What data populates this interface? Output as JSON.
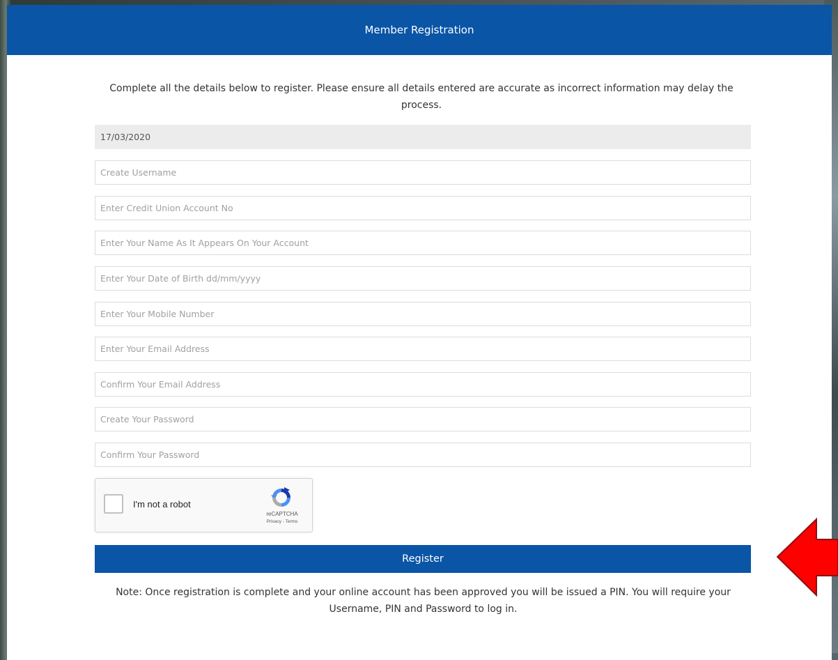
{
  "header": {
    "title": "Member Registration"
  },
  "intro": {
    "text": "Complete all the details below to register. Please ensure all details entered are accurate as incorrect information may delay the process."
  },
  "form": {
    "date": {
      "value": "17/03/2020"
    },
    "fields": [
      {
        "placeholder": "Create Username"
      },
      {
        "placeholder": "Enter Credit Union Account No"
      },
      {
        "placeholder": "Enter Your Name As It Appears On Your Account"
      },
      {
        "placeholder": "Enter Your Date of Birth dd/mm/yyyy"
      },
      {
        "placeholder": "Enter Your Mobile Number"
      },
      {
        "placeholder": "Enter Your Email Address"
      },
      {
        "placeholder": "Confirm Your Email Address"
      },
      {
        "placeholder": "Create Your Password"
      },
      {
        "placeholder": "Confirm Your Password"
      }
    ]
  },
  "captcha": {
    "label": "I'm not a robot",
    "brand": "reCAPTCHA",
    "links": "Privacy - Terms",
    "icon": "recaptcha-icon"
  },
  "register": {
    "label": "Register"
  },
  "note": {
    "text": "Note: Once registration is complete and your online account has been approved you will be issued a PIN. You will require your Username, PIN and Password to log in."
  },
  "annotation": {
    "icon": "arrow-left-icon",
    "color": "#ff0000"
  },
  "colors": {
    "brand": "#0a55a6"
  }
}
